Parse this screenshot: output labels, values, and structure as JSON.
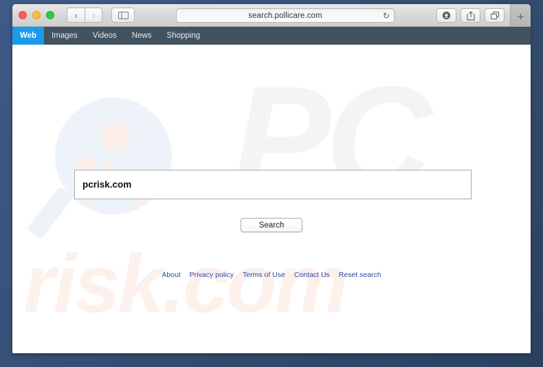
{
  "browser": {
    "traffic_lights": [
      "close",
      "minimize",
      "maximize"
    ],
    "back_label": "‹",
    "forward_label": "›",
    "sidebar_icon": "sidebar-icon",
    "url": "search.pollicare.com",
    "reload_label": "↻",
    "download_icon": "download-icon",
    "share_icon": "share-icon",
    "tabs_icon": "tabs-icon",
    "new_tab_label": "+"
  },
  "site_nav": {
    "items": [
      {
        "label": "Web",
        "active": true
      },
      {
        "label": "Images",
        "active": false
      },
      {
        "label": "Videos",
        "active": false
      },
      {
        "label": "News",
        "active": false
      },
      {
        "label": "Shopping",
        "active": false
      }
    ],
    "active_color": "#1a9ae8",
    "bar_color": "#43525f"
  },
  "page": {
    "watermark_pc": "PC",
    "watermark_risk": "risk.com",
    "search": {
      "value": "pcrisk.com",
      "placeholder": ""
    },
    "search_button_label": "Search",
    "footer_links": [
      "About",
      "Privacy policy",
      "Terms of Use",
      "Contact Us",
      "Reset search"
    ],
    "link_color": "#2b48ad"
  }
}
